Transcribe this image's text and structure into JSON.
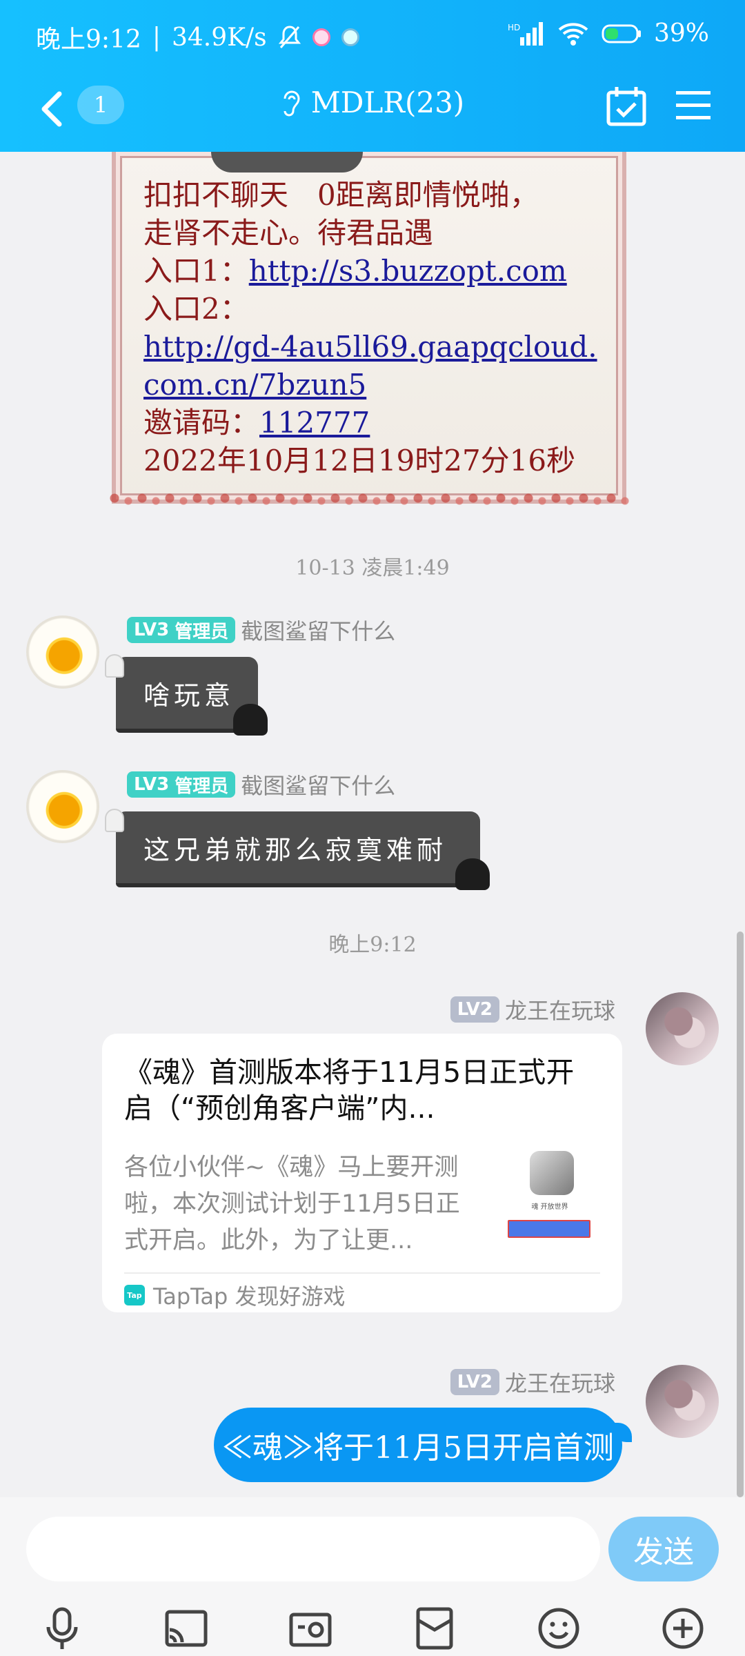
{
  "status_bar": {
    "time": "晚上9:12",
    "speed": "34.9K/s",
    "battery": "39%"
  },
  "header": {
    "unread_count": "1",
    "title": "MDLR(23)"
  },
  "framed_message": {
    "line1": "扣扣不聊天　0距离即情悦啪，",
    "line2": "走肾不走心。待君品遇",
    "entry1_label": "入口1：",
    "entry1_link": "http://s3.buzzopt.com",
    "entry2_label": "入口2：",
    "entry2_link": "http://gd-4au5ll69.gaapqcloud.com.cn/7bzun5",
    "invite_label": "邀请码：",
    "invite_code": "112777",
    "date": "2022年10月12日19时27分16秒"
  },
  "timestamps": {
    "t1": "10-13  凌晨1:49",
    "t2": "晚上9:12"
  },
  "messages": [
    {
      "level": "LV3",
      "role": "管理员",
      "sender": "截图鲨留下什么",
      "text": "啥玩意"
    },
    {
      "level": "LV3",
      "role": "管理员",
      "sender": "截图鲨留下什么",
      "text": "这兄弟就那么寂寞难耐"
    },
    {
      "level": "LV2",
      "sender": "龙王在玩球"
    },
    {
      "level": "LV2",
      "sender": "龙王在玩球",
      "text": "≪魂≫将于11月5日开启首测"
    }
  ],
  "share_card": {
    "title": "《魂》首测版本将于11月5日正式开启（“预创角客户端”内...",
    "description": "各位小伙伴~《魂》马上要开测啦，本次测试计划于11月5日正式开启。此外，为了让更...",
    "source_logo": "Tap",
    "source": "TapTap 发现好游戏",
    "thumb_caption": "魂 开放世界"
  },
  "composer": {
    "placeholder": "",
    "send_label": "发送"
  },
  "icons": [
    "microphone-icon",
    "screen-cast-icon",
    "photo-icon",
    "red-packet-icon",
    "emoji-icon",
    "plus-icon"
  ]
}
